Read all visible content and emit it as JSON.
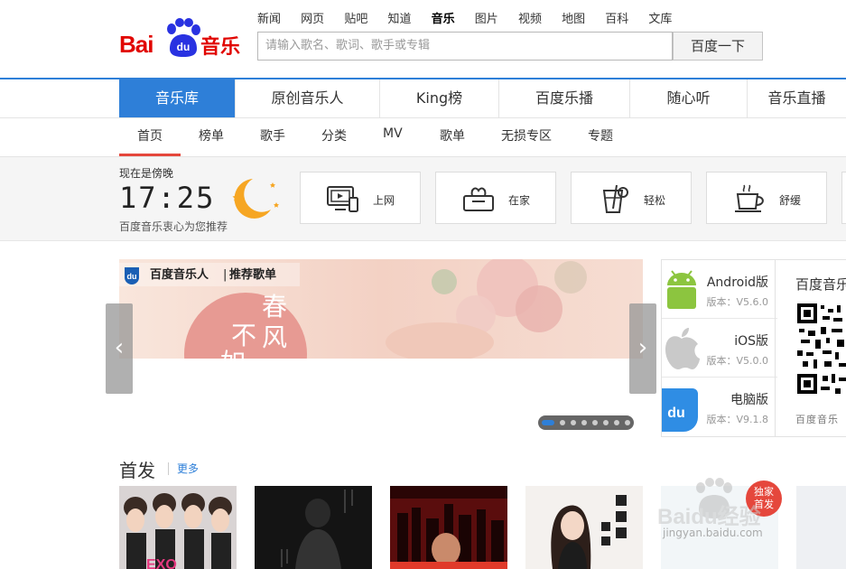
{
  "logo": {
    "bai": "Bai",
    "du": "du",
    "music": "音乐"
  },
  "topnav": [
    "新闻",
    "网页",
    "贴吧",
    "知道",
    "音乐",
    "图片",
    "视频",
    "地图",
    "百科",
    "文库"
  ],
  "search": {
    "placeholder": "请输入歌名、歌词、歌手或专辑",
    "button": "百度一下"
  },
  "mainnav": [
    "音乐库",
    "原创音乐人",
    "King榜",
    "百度乐播",
    "随心听",
    "音乐直播"
  ],
  "subnav": [
    "首页",
    "榜单",
    "歌手",
    "分类",
    "MV",
    "歌单",
    "无损专区",
    "专题"
  ],
  "time_strip": {
    "now_label": "现在是傍晚",
    "clock": "17:25",
    "recommend": "百度音乐衷心为您推荐"
  },
  "scenes": [
    {
      "label": "上网",
      "icon": "monitor-icon"
    },
    {
      "label": "在家",
      "icon": "tissue-box-icon"
    },
    {
      "label": "轻松",
      "icon": "drink-icon"
    },
    {
      "label": "舒缓",
      "icon": "coffee-cup-icon"
    }
  ],
  "banner": {
    "brand": "百度音乐人",
    "sep": "|",
    "tag": "推荐歌单",
    "poster_chars": [
      "春",
      "风",
      "不",
      "如"
    ]
  },
  "apps": [
    {
      "name": "Android版",
      "version": "版本：V5.6.0"
    },
    {
      "name": "iOS版",
      "version": "版本：V5.0.0"
    },
    {
      "name": "电脑版",
      "version": "版本：V9.1.8"
    }
  ],
  "qr": {
    "title": "百度音乐",
    "caption": "百度音乐"
  },
  "first_release": {
    "title": "首发",
    "more": "更多"
  },
  "badge": {
    "line1": "独家",
    "line2": "首发"
  },
  "watermark": {
    "text": "jingyan.baidu.com",
    "brand": "Baidu经验"
  },
  "colors": {
    "brand_red": "#e10601",
    "accent_blue": "#2e7fd8",
    "underline_red": "#e5473c"
  }
}
